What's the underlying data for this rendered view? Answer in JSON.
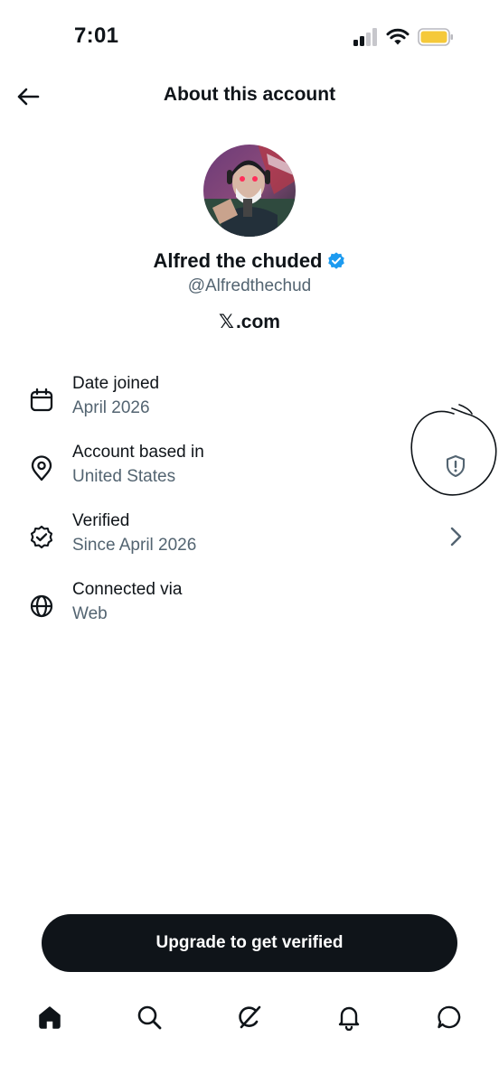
{
  "status_bar": {
    "time": "7:01",
    "icons": [
      "cellular-signal-icon",
      "wifi-icon",
      "battery-icon"
    ],
    "battery_color": "#f5c93a"
  },
  "header": {
    "back_icon": "arrow-left-icon",
    "title": "About this account"
  },
  "profile": {
    "display_name": "Alfred the chuded",
    "verified_badge": "verified-badge-icon",
    "verified_color": "#1d9bf0",
    "handle": "@Alfredthechud",
    "source_logo": "𝕏",
    "source_domain": ".com"
  },
  "info_rows": [
    {
      "icon": "calendar-icon",
      "label": "Date joined",
      "value": "April 2026"
    },
    {
      "icon": "location-pin-icon",
      "label": "Account based in",
      "value": "United States",
      "trailing": "shield-alert-icon"
    },
    {
      "icon": "verified-outline-icon",
      "label": "Verified",
      "value": "Since April 2026",
      "trailing": "chevron-right-icon"
    },
    {
      "icon": "globe-icon",
      "label": "Connected via",
      "value": "Web"
    }
  ],
  "upgrade_button": {
    "label": "Upgrade to get verified"
  },
  "bottom_nav": {
    "items": [
      "home-icon",
      "search-icon",
      "grok-icon",
      "notifications-bell-icon",
      "messages-icon"
    ]
  },
  "colors": {
    "text_primary": "#0f1419",
    "text_secondary": "#536471",
    "button_bg": "#0f1419"
  }
}
